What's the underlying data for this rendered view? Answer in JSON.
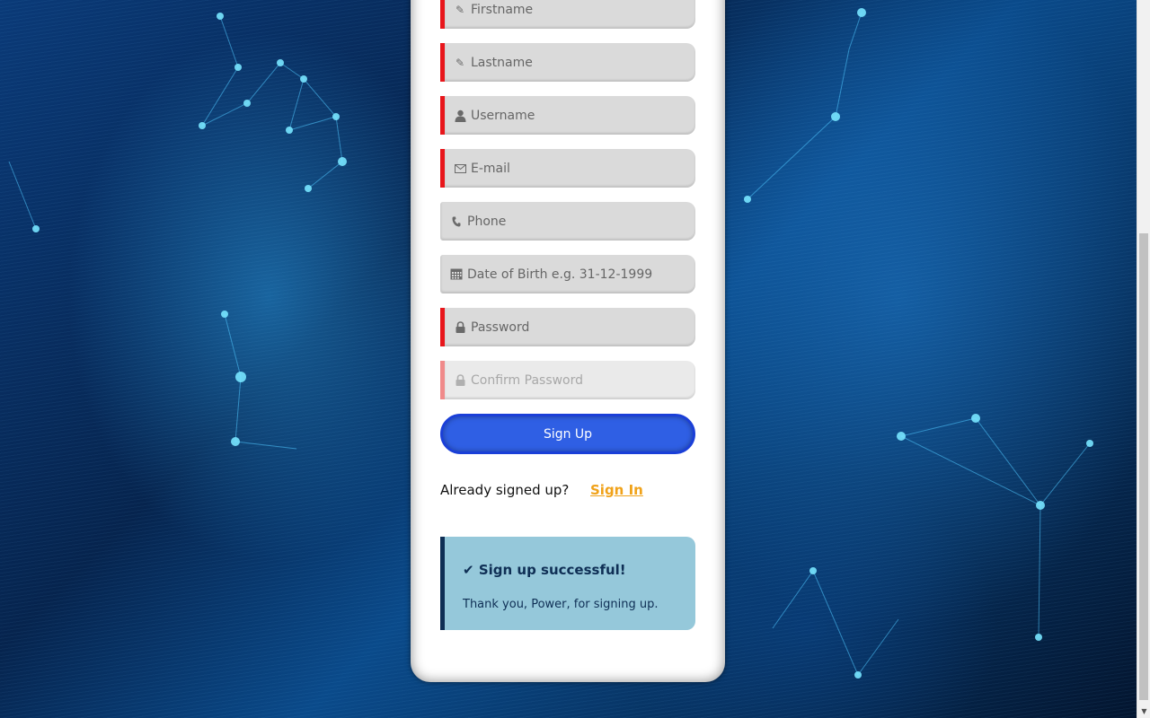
{
  "form": {
    "fields": [
      {
        "name": "firstname",
        "placeholder": "Firstname",
        "icon": "pencil-icon",
        "required": true
      },
      {
        "name": "lastname",
        "placeholder": "Lastname",
        "icon": "pencil-icon",
        "required": true
      },
      {
        "name": "username",
        "placeholder": "Username",
        "icon": "user-icon",
        "required": true
      },
      {
        "name": "email",
        "placeholder": "E-mail",
        "icon": "envelope-icon",
        "required": true
      },
      {
        "name": "phone",
        "placeholder": "Phone",
        "icon": "phone-icon",
        "required": false
      },
      {
        "name": "dob",
        "placeholder": "Date of Birth e.g. 31-12-1999",
        "icon": "calendar-icon",
        "required": false
      },
      {
        "name": "password",
        "placeholder": "Password",
        "icon": "lock-icon",
        "required": true
      },
      {
        "name": "confirm_password",
        "placeholder": "Confirm Password",
        "icon": "lock-icon",
        "required": true
      }
    ],
    "signup_label": "Sign Up"
  },
  "signin": {
    "prompt": "Already signed up?",
    "link_label": "Sign In"
  },
  "alert": {
    "check": "✔",
    "title": "Sign up successful!",
    "message": "Thank you, Power, for signing up."
  },
  "colors": {
    "required_bar": "#e8161b",
    "button": "#2f5fe4",
    "link": "#f0a21a",
    "alert_bg": "#95c8da",
    "alert_border": "#0f2f55"
  }
}
